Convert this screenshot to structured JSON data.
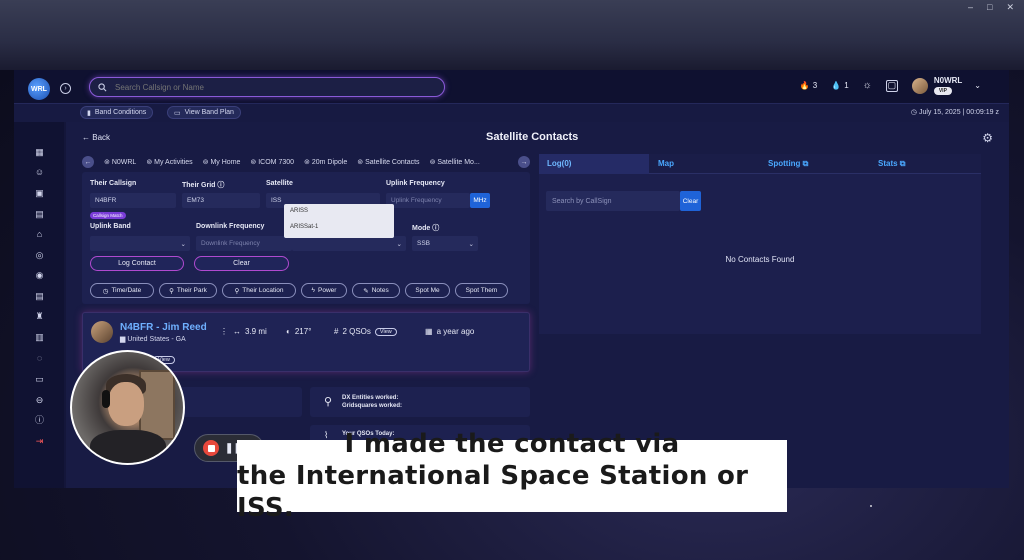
{
  "window": {
    "controls": [
      "–",
      "□",
      "✕"
    ]
  },
  "header": {
    "logo": "WRL",
    "search_placeholder": "Search Callsign or Name",
    "flame_count": "3",
    "drop_count": "1",
    "callsign": "N0WRL",
    "badge": "VIP"
  },
  "subbar": {
    "band_conditions": "Band Conditions",
    "view_band_plan": "View Band Plan",
    "datetime": "July 15, 2025 | 00:09:19 z"
  },
  "page": {
    "back": "Back",
    "title": "Satellite Contacts"
  },
  "breadcrumb": [
    "N0WRL",
    "My Activities",
    "My Home",
    "ICOM 7300",
    "20m Dipole",
    "Satellite Contacts",
    "Satellite Mo..."
  ],
  "form": {
    "their_callsign_label": "Their Callsign",
    "their_callsign_value": "N4BFR",
    "callsign_match": "Callsign Match",
    "their_grid_label": "Their Grid",
    "their_grid_value": "EM73",
    "satellite_label": "Satellite",
    "satellite_value": "ISS",
    "uplink_frequency_label": "Uplink Frequency",
    "uplink_frequency_placeholder": "Uplink Frequency",
    "mhz": "MHz",
    "uplink_band_label": "Uplink Band",
    "downlink_frequency_label": "Downlink Frequency",
    "downlink_frequency_placeholder": "Downlink Frequency",
    "mode_label": "Mode",
    "mode_value": "SSB",
    "log_contact": "Log Contact",
    "clear": "Clear",
    "dropdown_options": [
      "ARISS",
      "ARISSat-1"
    ],
    "pills": [
      "Time/Date",
      "Their Park",
      "Their Location",
      "Power",
      "Notes",
      "Spot Me",
      "Spot Them"
    ]
  },
  "contact_card": {
    "name": "N4BFR - Jim Reed",
    "location": "United States - GA",
    "distance": "3.9 mi",
    "heading": "217°",
    "qsos": "2 QSOs",
    "view": "View",
    "last_seen": "a year ago",
    "view2": "View"
  },
  "stats": {
    "dx_entities": "DX Entities worked:",
    "gridsquares": "Gridsquares worked:",
    "your_qsos_today": "Your QSOs Today:"
  },
  "right_panel": {
    "tabs": [
      "Log(0)",
      "Map",
      "Spotting",
      "Stats"
    ],
    "search_placeholder": "Search by CallSign",
    "clear": "Clear",
    "empty": "No Contacts Found"
  },
  "caption": {
    "line1": "I made the contact via",
    "line2": "the International Space Station or ISS."
  },
  "colors": {
    "accent_blue": "#1f63d8",
    "link_blue": "#4aa8ff",
    "purple_glow": "#8a5ad8",
    "flame": "#ff9a3c",
    "drop": "#4dc6ff"
  }
}
